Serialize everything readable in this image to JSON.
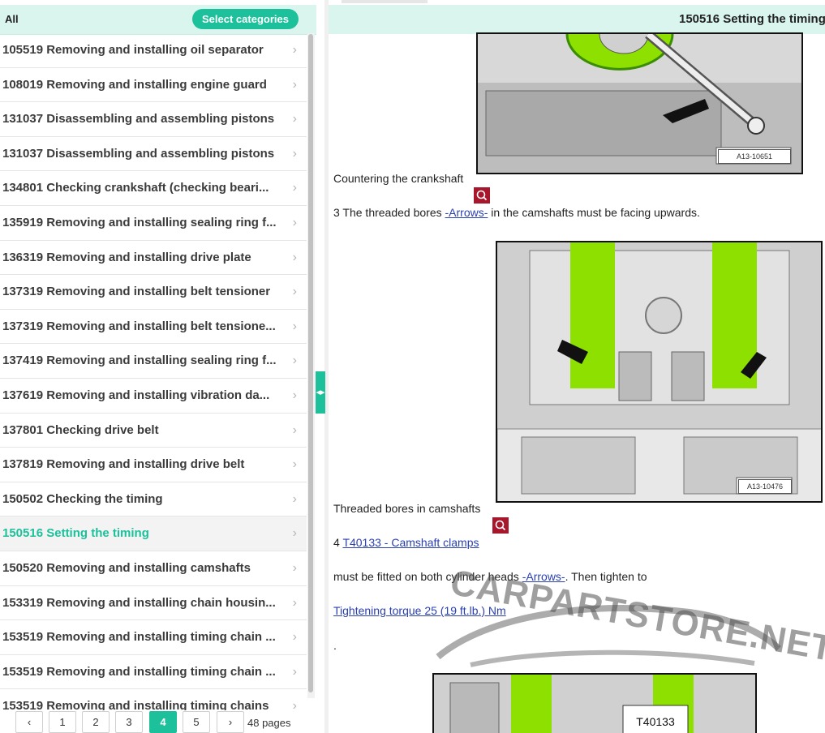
{
  "left": {
    "filter_label": "All",
    "select_categories": "Select categories",
    "items": [
      {
        "label": "105519 Removing and installing oil separator",
        "active": false
      },
      {
        "label": "108019 Removing and installing engine guard",
        "active": false
      },
      {
        "label": "131037 Disassembling and assembling pistons",
        "active": false
      },
      {
        "label": "131037 Disassembling and assembling pistons",
        "active": false
      },
      {
        "label": "134801 Checking crankshaft (checking beari...",
        "active": false
      },
      {
        "label": "135919 Removing and installing sealing ring f...",
        "active": false
      },
      {
        "label": "136319 Removing and installing drive plate",
        "active": false
      },
      {
        "label": "137319 Removing and installing belt tensioner",
        "active": false
      },
      {
        "label": "137319 Removing and installing belt tensione...",
        "active": false
      },
      {
        "label": "137419 Removing and installing sealing ring f...",
        "active": false
      },
      {
        "label": "137619 Removing and installing vibration da...",
        "active": false
      },
      {
        "label": "137801 Checking drive belt",
        "active": false
      },
      {
        "label": "137819 Removing and installing drive belt",
        "active": false
      },
      {
        "label": "150502 Checking the timing",
        "active": false
      },
      {
        "label": "150516 Setting the timing",
        "active": true
      },
      {
        "label": "150520 Removing and installing camshafts",
        "active": false
      },
      {
        "label": "153319 Removing and installing chain housin...",
        "active": false
      },
      {
        "label": "153519 Removing and installing timing chain ...",
        "active": false
      },
      {
        "label": "153519 Removing and installing timing chain ...",
        "active": false
      },
      {
        "label": "153519 Removing and installing timing chains",
        "active": false
      }
    ],
    "pagination": {
      "prev": "‹",
      "pages": [
        "1",
        "2",
        "3",
        "4",
        "5"
      ],
      "current": "4",
      "next": "›",
      "total_label": "48 pages"
    }
  },
  "right": {
    "title": "150516 Setting the timing",
    "fig1_label": "A13-10651",
    "caption1": "Countering the crankshaft",
    "step3": {
      "prefix": "3 The threaded bores ",
      "link": "-Arrows-",
      "suffix": " in the camshafts must be facing upwards."
    },
    "fig2_label": "A13-10476",
    "caption2": "Threaded bores in camshafts",
    "step4": {
      "number": "4 ",
      "link": "T40133 - Camshaft clamps"
    },
    "step4_text": {
      "prefix": "must be fitted on both cylinder heads ",
      "link": "-Arrows-",
      "suffix": ". Then tighten to"
    },
    "torque_link": "Tightening torque 25 (19 ft.lb.) Nm",
    "dot": ".",
    "fig3_label": "T40133",
    "watermark": "CARPARTSTORE.NET"
  },
  "colors": {
    "accent": "#1cc19b",
    "header_bg": "#d9f5ee",
    "zoom_button": "#a8162b",
    "link": "#2a3fb0",
    "highlight_green": "#8ee000"
  }
}
